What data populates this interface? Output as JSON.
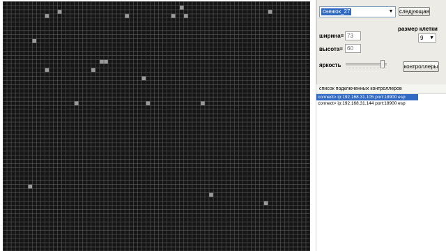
{
  "preset_combo": {
    "value": "снежок_27"
  },
  "buttons": {
    "next": "следующая",
    "controllers": "контроллеры"
  },
  "cell_size": {
    "label": "размер клетки",
    "value": "9"
  },
  "width_field": {
    "label": "ширина=",
    "value": "73"
  },
  "height_field": {
    "label": "высота=",
    "value": "60"
  },
  "brightness": {
    "label": "яркость",
    "value": 0.95
  },
  "connections": {
    "header": "список подключенных контроллеров",
    "items": [
      {
        "text": "connect> ip:192.168.31.105  port:18900 esp",
        "selected": true
      },
      {
        "text": "connect> ip:192.168.31.144  port:18900 esp",
        "selected": false
      }
    ]
  },
  "grid": {
    "columns": 73,
    "rows": 60,
    "colors": {
      "background": "#151515",
      "line": "#5a5a5a",
      "lit": "#9a9a9a"
    },
    "lit_cells": [
      [
        13,
        2
      ],
      [
        10,
        3
      ],
      [
        29,
        3
      ],
      [
        43,
        3
      ],
      [
        63,
        2
      ],
      [
        40,
        3
      ],
      [
        42,
        1
      ],
      [
        7,
        9
      ],
      [
        10,
        16
      ],
      [
        21,
        16
      ],
      [
        23,
        14
      ],
      [
        24,
        14
      ],
      [
        33,
        18
      ],
      [
        17,
        24
      ],
      [
        34,
        24
      ],
      [
        47,
        24
      ],
      [
        6,
        44
      ],
      [
        49,
        46
      ],
      [
        62,
        48
      ]
    ]
  }
}
